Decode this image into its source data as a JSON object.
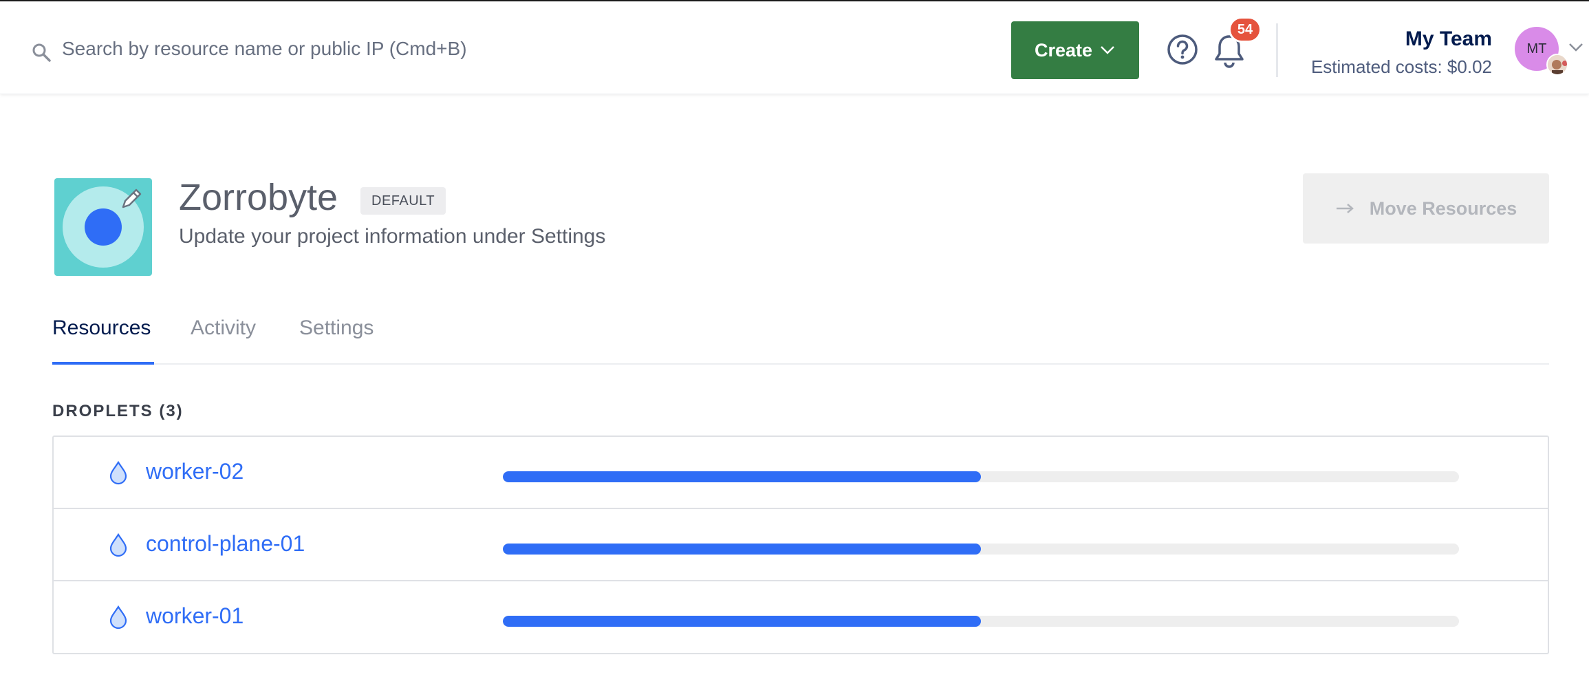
{
  "topbar": {
    "search_placeholder": "Search by resource name or public IP (Cmd+B)",
    "create_label": "Create",
    "notification_count": "54",
    "team_name": "My Team",
    "estimated_costs": "Estimated costs: $0.02",
    "avatar_initials": "MT"
  },
  "project": {
    "name": "Zorrobyte",
    "badge": "DEFAULT",
    "subtitle": "Update your project information under Settings",
    "move_resources_label": "Move Resources"
  },
  "tabs": [
    {
      "label": "Resources",
      "active": true
    },
    {
      "label": "Activity",
      "active": false
    },
    {
      "label": "Settings",
      "active": false
    }
  ],
  "droplets": {
    "heading": "DROPLETS (3)",
    "items": [
      {
        "name": "worker-02",
        "progress": 0.5
      },
      {
        "name": "control-plane-01",
        "progress": 0.5
      },
      {
        "name": "worker-01",
        "progress": 0.5
      }
    ]
  },
  "colors": {
    "brand_blue": "#2f6df6",
    "create_green": "#347d43",
    "badge_red": "#e5533d",
    "logo_teal": "#5fd0d0",
    "avatar_purple": "#d98be8"
  },
  "icons": [
    "search-icon",
    "chevron-down-icon",
    "help-icon",
    "bell-icon",
    "pencil-icon",
    "arrow-right-icon",
    "droplet-icon"
  ]
}
